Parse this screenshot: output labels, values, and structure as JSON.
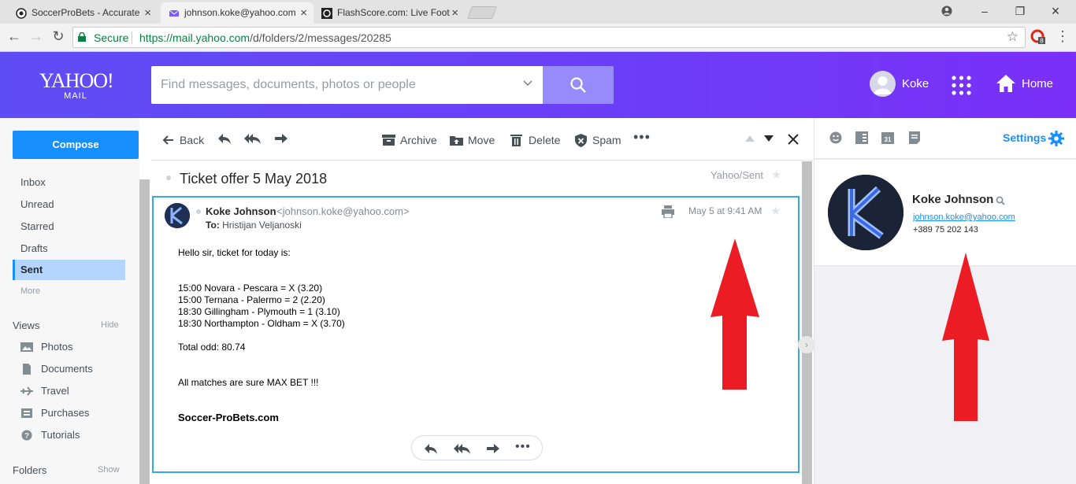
{
  "browser": {
    "tabs": [
      {
        "title": "SoccerProBets - Accurate",
        "active": false
      },
      {
        "title": "johnson.koke@yahoo.com",
        "active": true
      },
      {
        "title": "FlashScore.com: Live Foot",
        "active": false
      }
    ],
    "secure_label": "Secure",
    "url_host": "https://mail.yahoo.com",
    "url_path": "/d/folders/2/messages/20285",
    "ext_badge": "8"
  },
  "header": {
    "logo_big": "YAHOO!",
    "logo_small": "MAIL",
    "search_placeholder": "Find messages, documents, photos or people",
    "user_name": "Koke",
    "home_label": "Home"
  },
  "sidebar": {
    "compose_label": "Compose",
    "folders": [
      "Inbox",
      "Unread",
      "Starred",
      "Drafts",
      "Sent"
    ],
    "selected": "Sent",
    "more_label": "More",
    "views_label": "Views",
    "views_action": "Hide",
    "views": [
      "Photos",
      "Documents",
      "Travel",
      "Purchases",
      "Tutorials"
    ],
    "folders_label": "Folders",
    "folders_action": "Show"
  },
  "toolbar": {
    "back": "Back",
    "archive": "Archive",
    "move": "Move",
    "delete": "Delete",
    "spam": "Spam"
  },
  "message": {
    "subject": "Ticket offer 5 May 2018",
    "folder": "Yahoo/Sent",
    "from_name": "Koke Johnson",
    "from_email": "<johnson.koke@yahoo.com>",
    "to_label": "To:",
    "to_name": "Hristijan Veljanoski",
    "date": "May 5 at 9:41 AM",
    "body": {
      "greeting": "Hello sir, ticket for today is:",
      "lines": [
        "15:00 Novara - Pescara = X (3.20)",
        "15:00 Ternana - Palermo = 2 (2.20)",
        "18:30 Gillingham - Plymouth = 1 (3.10)",
        "18:30 Northampton - Oldham = X (3.70)"
      ],
      "total": "Total odd: 80.74",
      "note": "All matches are sure MAX BET !!!",
      "signature": "Soccer-ProBets.com"
    }
  },
  "contact": {
    "settings_label": "Settings",
    "name": "Koke Johnson",
    "email": "johnson.koke@yahoo.com",
    "phone": "+389 75 202 143"
  },
  "colors": {
    "accent": "#188fff",
    "header_start": "#5f4df4",
    "header_end": "#7b2ff7",
    "arrow": "#ec1c24",
    "selection": "#36a9e1"
  }
}
